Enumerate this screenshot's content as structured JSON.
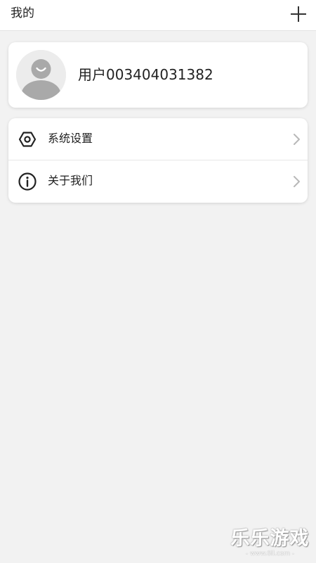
{
  "header": {
    "title": "我的",
    "add_icon": "plus-icon"
  },
  "profile": {
    "avatar_icon": "default-user-avatar",
    "username": "用户003404031382"
  },
  "menu": {
    "items": [
      {
        "icon": "settings-hexagon-icon",
        "label": "系统设置",
        "chevron": "chevron-right-icon"
      },
      {
        "icon": "info-circle-icon",
        "label": "关于我们",
        "chevron": "chevron-right-icon"
      }
    ]
  },
  "watermark": {
    "main": "乐乐游戏",
    "sub": "- www.6ll.com -"
  },
  "colors": {
    "background": "#f2f2f2",
    "card": "#ffffff",
    "text": "#222222",
    "chevron": "#b8b8b8",
    "avatar_figure": "#a9a9a9"
  }
}
